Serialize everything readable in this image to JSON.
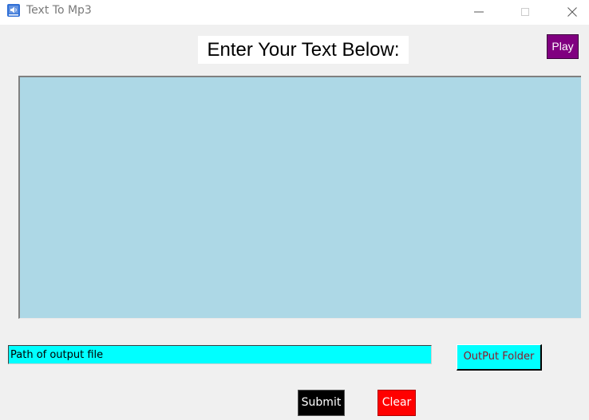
{
  "window": {
    "title": "Text To Mp3",
    "app_icon": "speaker-document-icon",
    "controls": {
      "minimize_icon": "minimize-icon",
      "maximize_icon": "maximize-icon",
      "close_icon": "close-icon"
    }
  },
  "header": {
    "label": "Enter Your Text Below:"
  },
  "toolbar": {
    "play_label": "Play"
  },
  "editor": {
    "value": "",
    "placeholder": ""
  },
  "output": {
    "path_value": "Path of output file",
    "folder_button_label": "OutPut Folder"
  },
  "actions": {
    "submit_label": "Submit",
    "clear_label": "Clear"
  },
  "colors": {
    "play_button": "#800080",
    "text_area": "#add8e6",
    "path_input": "#00ffff",
    "folder_button": "#00ffff",
    "folder_button_text": "#8b1a2b",
    "submit_button": "#000000",
    "clear_button": "#ff0000"
  }
}
